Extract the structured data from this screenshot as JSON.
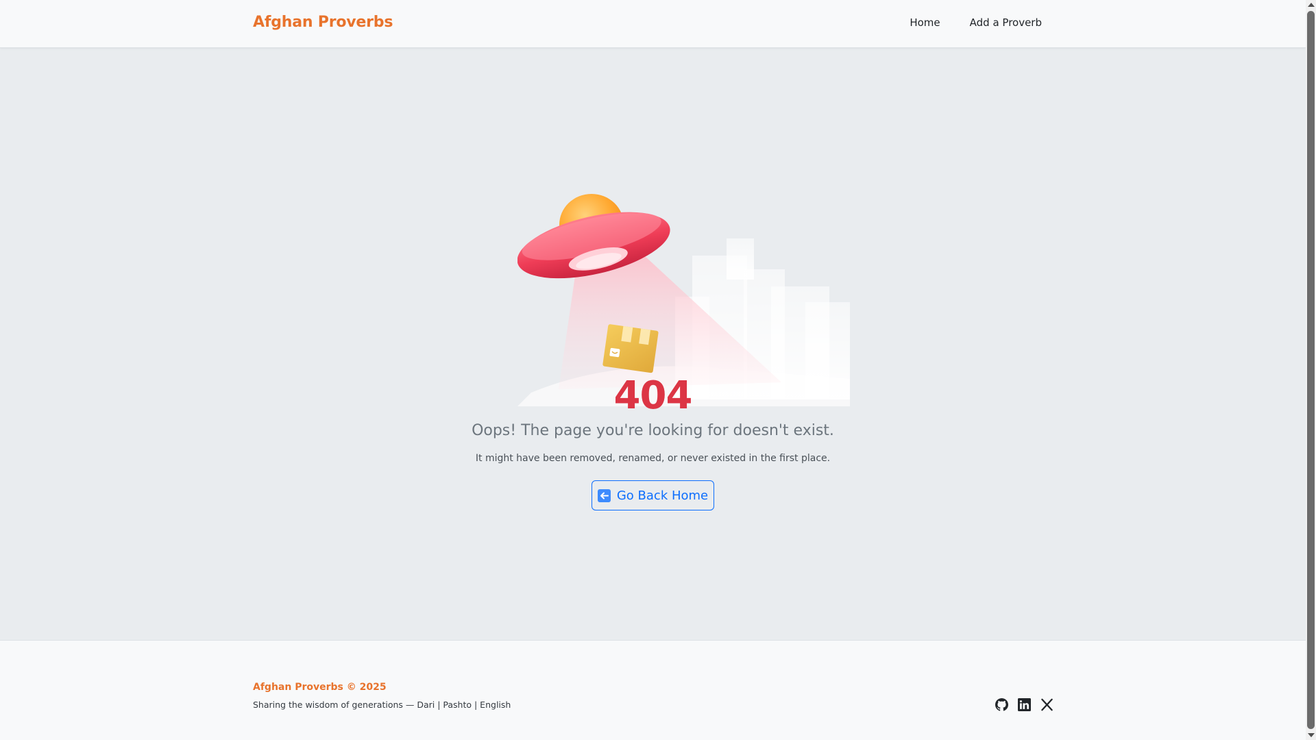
{
  "navbar": {
    "brand": "Afghan Proverbs",
    "links": [
      {
        "label": "Home"
      },
      {
        "label": "Add a Proverb"
      }
    ]
  },
  "error": {
    "code": "404",
    "title": "Oops! The page you're looking for doesn't exist.",
    "description": "It might have been removed, renamed, or never existed in the first place.",
    "button_label": "Go Back Home",
    "button_icon": "arrow-left-icon",
    "illustration": "ufo-abducting-box-illustration"
  },
  "footer": {
    "brand": "Afghan Proverbs © 2025",
    "tagline": "Sharing the wisdom of generations — Dari | Pashto | English",
    "social_icons": [
      "github-icon",
      "linkedin-icon",
      "x-icon"
    ]
  },
  "colors": {
    "brand": "#e8732c",
    "error": "#dc3545",
    "primary": "#0d6efd",
    "background": "#e9ecef"
  }
}
